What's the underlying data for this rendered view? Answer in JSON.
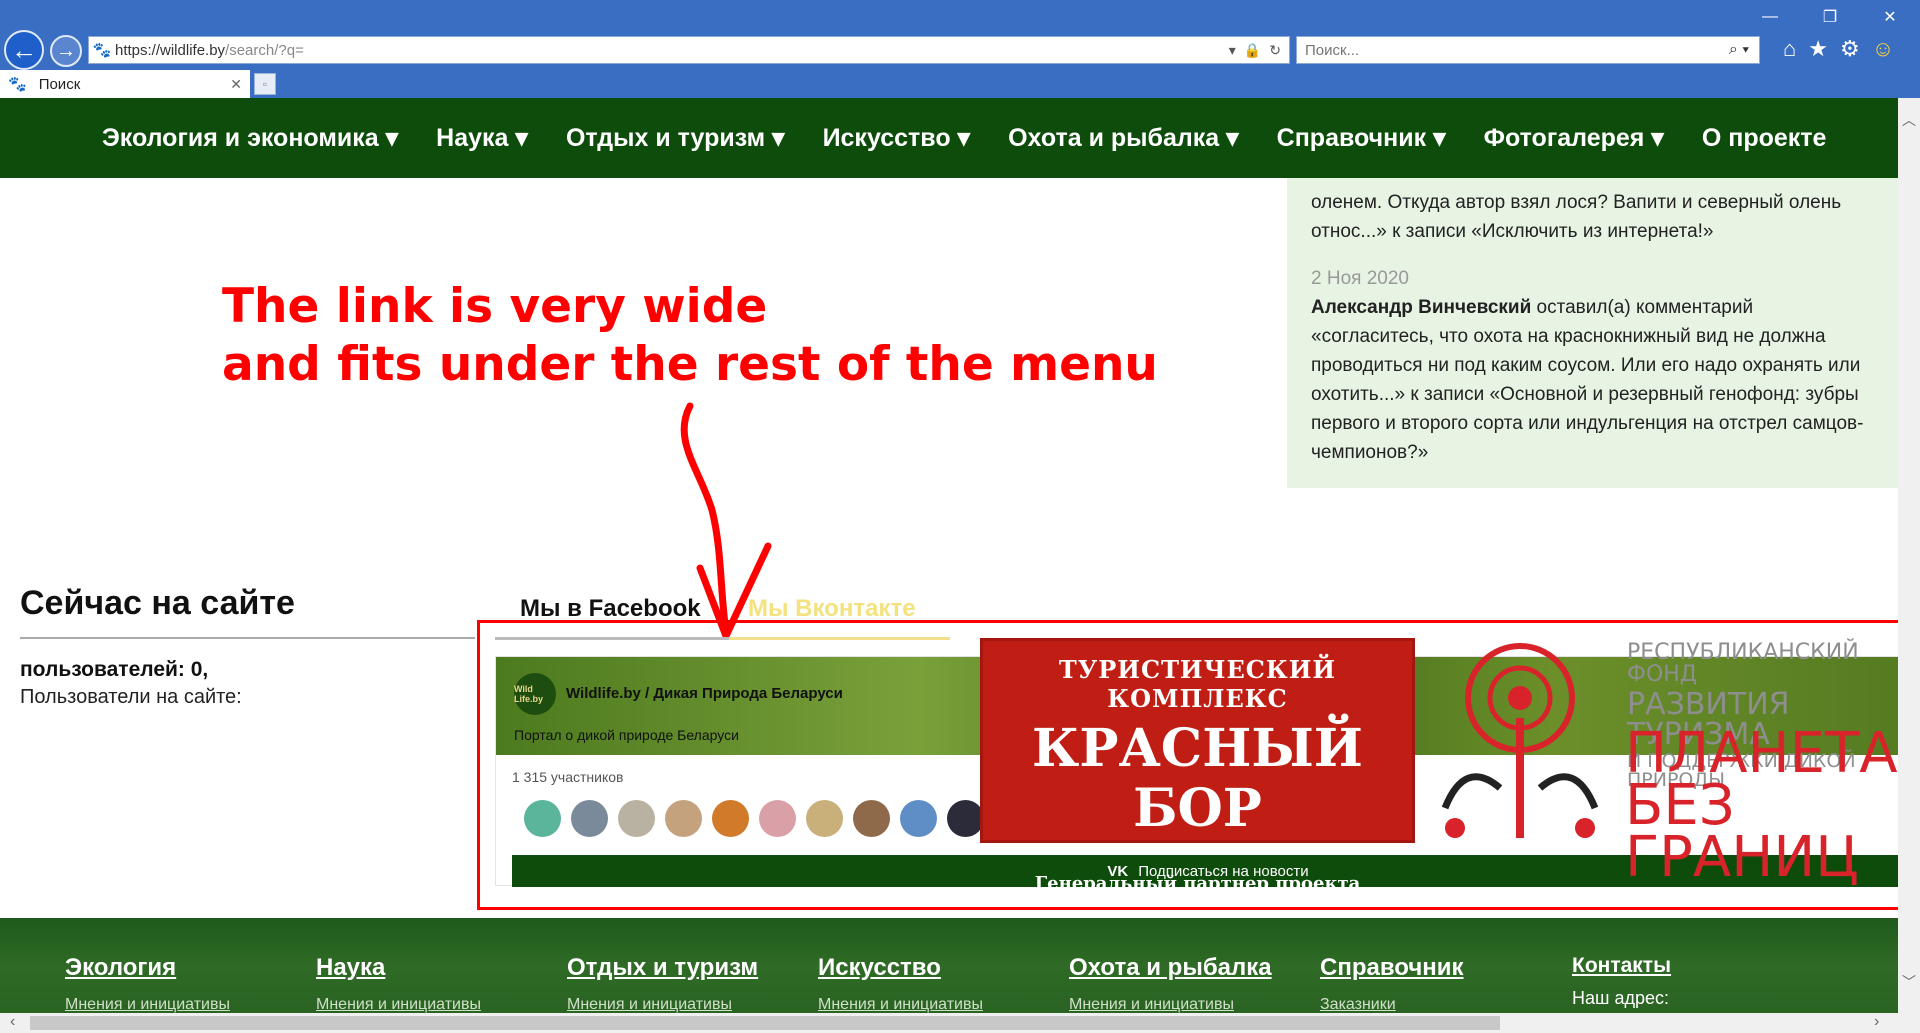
{
  "browser": {
    "url_main": "https://wildlife.by",
    "url_rest": "/search/?q=",
    "search_placeholder": "Поиск...",
    "tab_title": "Поиск"
  },
  "nav": {
    "items": [
      "Экология и экономика ▾",
      "Наука ▾",
      "Отдых и туризм ▾",
      "Искусство ▾",
      "Охота и рыбалка ▾",
      "Справочник ▾",
      "Фотогалерея ▾",
      "О проекте"
    ]
  },
  "comments": {
    "first_tail_line1": "оленем. Откуда автор взял лося? Вапити и северный олень",
    "first_tail_line2": "относ...» к записи «Исключить из интернета!»",
    "second_date": "2 Ноя 2020",
    "second_author": "Александр Винчевский",
    "second_text": " оставил(а) комментарий «согласитесь, что охота на краснокнижный вид не должна проводиться ни под каким соусом. Или его надо охранять или охотить...» к записи «Основной и резервный генофонд: зубры первого и второго сорта или индульгенция на отстрел самцов-чемпионов?»"
  },
  "annotation": {
    "line1": "The link is very wide",
    "line2": "and fits under the rest of the menu"
  },
  "online": {
    "title": "Сейчас на сайте",
    "users": "пользователей: 0,",
    "on_site": "Пользователи на сайте:"
  },
  "social": {
    "tab_facebook": "Мы в Facebook",
    "tab_vk": "Мы Вконтакте"
  },
  "vk_widget": {
    "logo": "Wild Life.by",
    "group_name": "Wildlife.by / Дикая Природа Беларуси",
    "description": "Портал о дикой природе Беларуси",
    "members": "1 315 участников",
    "subscribe": "Подписаться на новости",
    "subscribe_icon": "VK"
  },
  "banners": {
    "bor_line1": "ТУРИСТИЧЕСКИЙ КОМПЛЕКС",
    "bor_line2": "КРАСНЫЙ БОР",
    "bor_line3": "Генеральный партнер проекта",
    "fund_line1": "РЕСПУБЛИКАНСКИЙ ФОНД",
    "fund_line2": "РАЗВИТИЯ ТУРИЗМА",
    "fund_line3": "И ПОДДЕРЖКИ ДИКОЙ ПРИРОДЫ",
    "planet_line1": "ПЛАНЕТА",
    "planet_line2": "БЕЗ ГРАНИЦ"
  },
  "footer": {
    "cols": [
      {
        "title": "Экология",
        "sub": "Мнения и инициативы"
      },
      {
        "title": "Наука",
        "sub": "Мнения и инициативы"
      },
      {
        "title": "Отдых и туризм",
        "sub": "Мнения и инициативы"
      },
      {
        "title": "Искусство",
        "sub": "Мнения и инициативы"
      },
      {
        "title": "Охота и рыбалка",
        "sub": "Мнения и инициативы"
      },
      {
        "title": "Справочник",
        "sub": "Заказники"
      }
    ],
    "contacts_title": "Контакты",
    "contacts_sub": "Наш адрес:"
  },
  "colors": {
    "nav_bg": "#0e4c0b",
    "annotation_red": "#ff0000",
    "comments_bg": "#e7f4e4",
    "chrome_blue": "#3a6ec2"
  }
}
